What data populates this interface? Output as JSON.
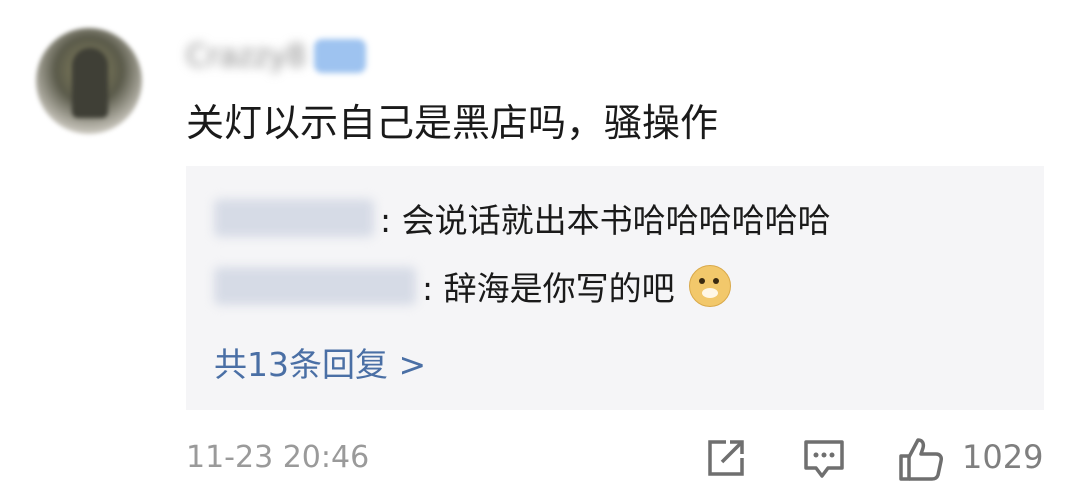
{
  "comment": {
    "username": "Crazzy8",
    "text": "关灯以示自己是黑店吗，骚操作",
    "timestamp": "11-23 20:46",
    "like_count": "1029"
  },
  "replies": [
    {
      "name": "旧梦·千里",
      "text": ": 会说话就出本书哈哈哈哈哈哈"
    },
    {
      "name": "Ski·青春期",
      "text": ": 辞海是你写的吧",
      "emoji": "doge-emoji"
    }
  ],
  "more_replies": "共13条回复 >",
  "icons": {
    "share": "share-icon",
    "comment": "comment-icon",
    "like": "thumbs-up-icon"
  },
  "colors": {
    "reply_bg": "#f5f5f7",
    "link": "#4a6fa5",
    "muted": "#9a9a9a"
  }
}
